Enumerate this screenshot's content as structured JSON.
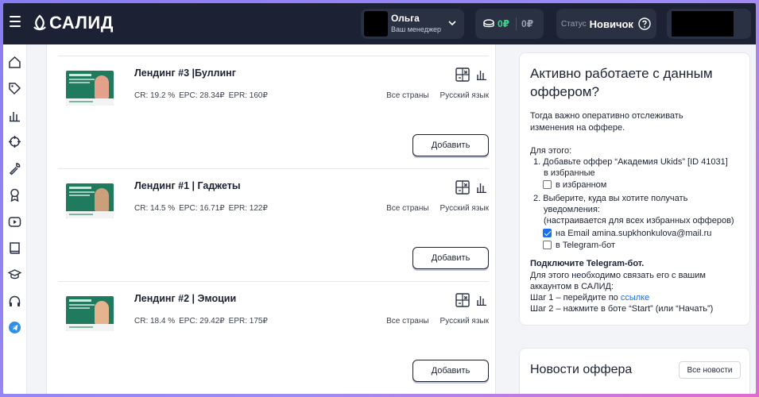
{
  "header": {
    "logo_text": "САЛИД",
    "user": {
      "name": "Ольга",
      "role": "Ваш менеджер"
    },
    "balance": {
      "primary": "0₽",
      "secondary": "0₽"
    },
    "status": {
      "label": "Статус",
      "value": "Новичок"
    }
  },
  "sidebar": {
    "items": [
      "home-icon",
      "tag-icon",
      "bar-chart-icon",
      "crosshair-icon",
      "wrench-icon",
      "award-icon",
      "video-icon",
      "book-icon",
      "graduation-cap-icon",
      "headphones-icon",
      "telegram-icon"
    ]
  },
  "landings": [
    {
      "title": "Лендинг #3 |Буллинг",
      "cr": "CR: 19.2 %",
      "epc": "EPC: 28.34₽",
      "epr": "EPR: 160₽",
      "countries": "Все страны",
      "language": "Русский язык",
      "button": "Добавить"
    },
    {
      "title": "Лендинг #1 | Гаджеты",
      "cr": "CR: 14.5 %",
      "epc": "EPC: 16.71₽",
      "epr": "EPR: 122₽",
      "countries": "Все страны",
      "language": "Русский язык",
      "button": "Добавить"
    },
    {
      "title": "Лендинг #2 | Эмоции",
      "cr": "CR: 18.4 %",
      "epc": "EPC: 29.42₽",
      "epr": "EPR: 175₽",
      "countries": "Все страны",
      "language": "Русский язык",
      "button": "Добавить"
    }
  ],
  "panel": {
    "title": "Активно работаете с данным оффером?",
    "intro_1": "Тогда важно оперативно отслеживать",
    "intro_2": "изменения на оффере.",
    "for_this": "Для этого:",
    "step1_a": "1. Добавьте оффер “Академия Ukids” [ID 41031]",
    "step1_b": "в избранные",
    "step1_check": "в избранном",
    "step2_a": "2. Выберите, куда вы хотите получать",
    "step2_b": "уведомления:",
    "step2_c": "(настраивается для всех избранных офферов)",
    "email_check": "на Email amina.supkhonkulova@mail.ru",
    "tg_check": "в Telegram-бот",
    "connect_title": "Подключите Telegram-бот.",
    "connect_1": "Для этого необходимо связать его с вашим",
    "connect_2": "аккаунтом в САЛИД:",
    "step_a_prefix": "Шаг 1 – перейдите по ",
    "step_a_link": "ссылке",
    "step_b": "Шаг 2 – нажмите в боте “Start” (или “Начать”)",
    "checks": {
      "favorite": false,
      "email": true,
      "telegram": false
    }
  },
  "news": {
    "title": "Новости оффера",
    "button": "Все новости"
  }
}
